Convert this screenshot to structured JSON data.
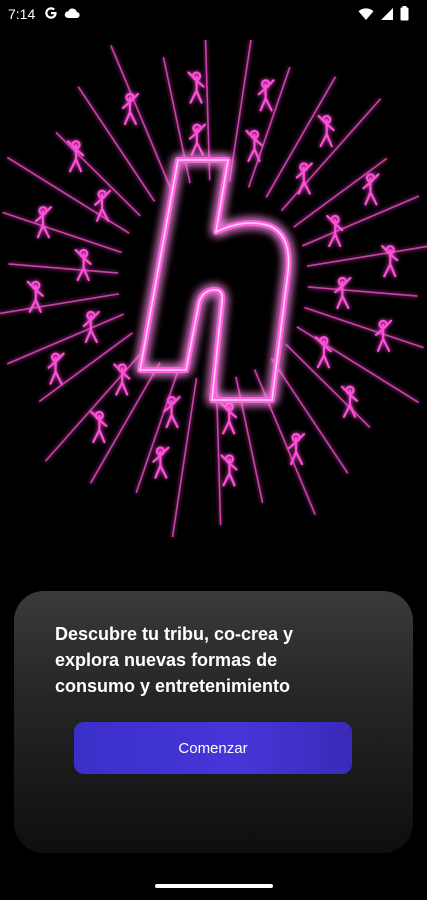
{
  "status_bar": {
    "time": "7:14",
    "left_icons": [
      "google-icon",
      "cloud-icon"
    ],
    "right_icons": [
      "wifi-icon",
      "signal-icon",
      "battery-icon"
    ]
  },
  "hero": {
    "logo_icon": "neon-h-logo-icon",
    "glow_color": "#ff4fd8",
    "background": "#000000"
  },
  "card": {
    "headline": "Descubre tu tribu, co-crea y\nexplora  nuevas formas de\nconsumo y entretenimiento",
    "button_label": "Comenzar",
    "button_color": "#4636d8"
  }
}
